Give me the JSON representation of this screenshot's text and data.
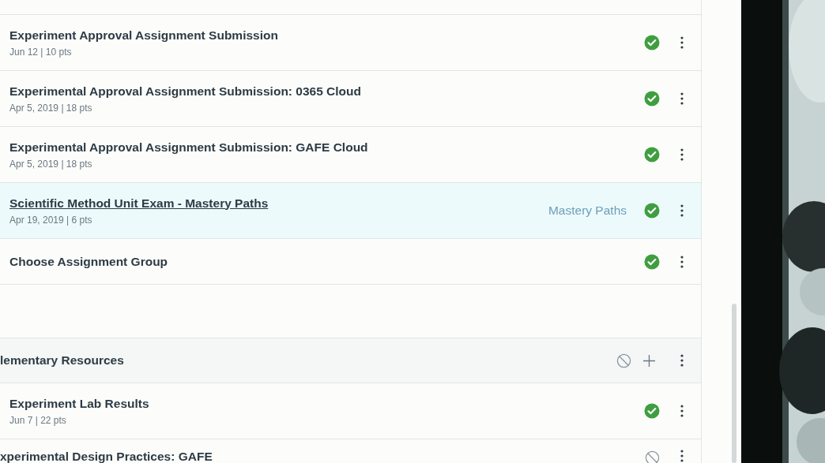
{
  "items": [
    {
      "title": "Experiment Approval Assignment Submission",
      "meta": "Jun 12 | 10 pts",
      "published": true,
      "hovered": false
    },
    {
      "title": "Experimental Approval Assignment Submission: 0365 Cloud",
      "meta": "Apr 5, 2019 | 18 pts",
      "published": true,
      "hovered": false
    },
    {
      "title": "Experimental Approval Assignment Submission: GAFE Cloud",
      "meta": "Apr 5, 2019 | 18 pts",
      "published": true,
      "hovered": false
    },
    {
      "title": "Scientific Method Unit Exam - Mastery Paths",
      "meta": "Apr 19, 2019 | 6 pts",
      "mastery_paths": "Mastery Paths",
      "published": true,
      "hovered": true
    },
    {
      "title": "Choose Assignment Group",
      "published": true,
      "hovered": false
    }
  ],
  "module": {
    "title": "lementary Resources",
    "published": false,
    "items": [
      {
        "title": "Experiment Lab Results",
        "meta": "Jun 7 | 22 pts",
        "published": true,
        "hovered": false
      },
      {
        "title": "xperimental Design Practices: GAFE",
        "published": false,
        "hovered": false
      }
    ]
  }
}
